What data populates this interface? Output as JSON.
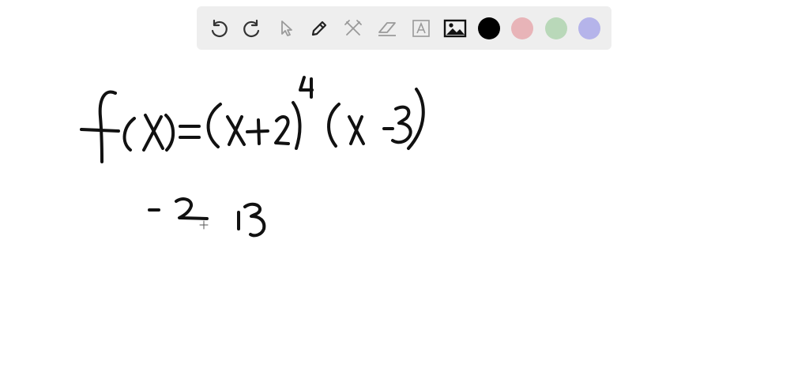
{
  "toolbar": {
    "tools": [
      {
        "name": "undo-icon",
        "state": "enabled"
      },
      {
        "name": "redo-icon",
        "state": "enabled"
      },
      {
        "name": "select-pointer-icon",
        "state": "disabled"
      },
      {
        "name": "pen-icon",
        "state": "active"
      },
      {
        "name": "tools-icon",
        "state": "disabled"
      },
      {
        "name": "eraser-icon",
        "state": "disabled"
      },
      {
        "name": "text-box-icon",
        "state": "disabled"
      },
      {
        "name": "image-icon",
        "state": "enabled"
      }
    ],
    "colors": {
      "black": "#000000",
      "red": "#e8b4b8",
      "green": "#b9d8b9",
      "purple": "#b5b4ea"
    },
    "selected_color": "black"
  },
  "whiteboard": {
    "ink_color": "#111111",
    "content": "handwritten"
  }
}
